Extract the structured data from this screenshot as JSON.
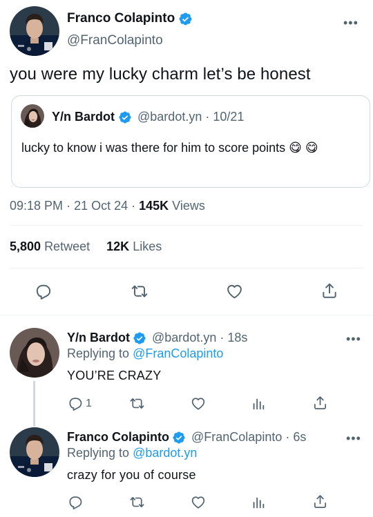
{
  "tweet": {
    "author_name": "Franco Colapinto",
    "author_handle": "@FranColapinto",
    "text": "you were my lucky charm let’s be honest",
    "quote": {
      "author_name": "Y/n Bardot",
      "author_handle": "@bardot.yn",
      "date": "· 10/21",
      "text": "lucky to know i was there for him to score points 😋 😋"
    },
    "time": "09:18 PM",
    "date": "21 Oct 24",
    "views_count": "145K",
    "views_label": "Views",
    "retweets_count": "5,800",
    "retweets_label": "Retweet",
    "likes_count": "12K",
    "likes_label": "Likes"
  },
  "replies": [
    {
      "author_name": "Y/n Bardot",
      "author_handle": "@bardot.yn",
      "time": "· 18s",
      "replying_prefix": "Replying to",
      "replying_to": "@FranColapinto",
      "text": "YOU’RE CRAZY",
      "reply_count": "1"
    },
    {
      "author_name": "Franco Colapinto",
      "author_handle": "@FranColapinto",
      "time": "· 6s",
      "replying_prefix": "Replying to",
      "replying_to": "@bardot.yn",
      "text": "crazy for you of course",
      "reply_count": ""
    }
  ],
  "colors": {
    "accent": "#1d9bf0",
    "text": "#0f1419",
    "secondary": "#536471",
    "border": "#cfd9de"
  }
}
